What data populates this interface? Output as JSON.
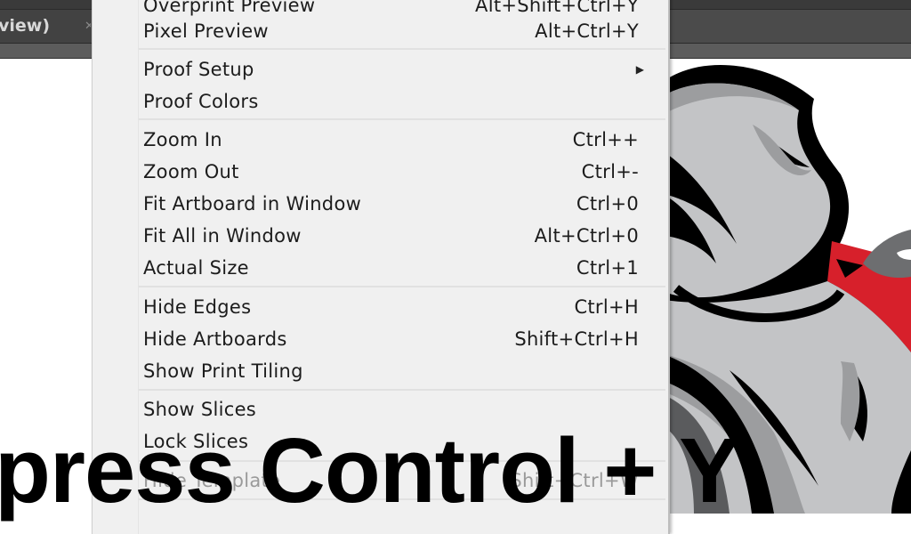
{
  "app": {
    "document_tab": {
      "label": "view)",
      "close_icon": "close-icon"
    }
  },
  "menu": {
    "items": [
      {
        "label": "Overprint Preview",
        "shortcut": "Alt+Shift+Ctrl+Y",
        "enabled": true
      },
      {
        "label": "Pixel Preview",
        "shortcut": "Alt+Ctrl+Y",
        "enabled": true
      },
      {
        "label": "Proof Setup",
        "shortcut": "",
        "submenu": true,
        "submenu_icon": "triangle-right-icon",
        "enabled": true
      },
      {
        "label": "Proof Colors",
        "shortcut": "",
        "enabled": true
      },
      {
        "label": "Zoom In",
        "shortcut": "Ctrl++",
        "enabled": true
      },
      {
        "label": "Zoom Out",
        "shortcut": "Ctrl+-",
        "enabled": true
      },
      {
        "label": "Fit Artboard in Window",
        "shortcut": "Ctrl+0",
        "enabled": true
      },
      {
        "label": "Fit All in Window",
        "shortcut": "Alt+Ctrl+0",
        "enabled": true
      },
      {
        "label": "Actual Size",
        "shortcut": "Ctrl+1",
        "enabled": true
      },
      {
        "label": "Hide Edges",
        "shortcut": "Ctrl+H",
        "enabled": true
      },
      {
        "label": "Hide Artboards",
        "shortcut": "Shift+Ctrl+H",
        "enabled": true
      },
      {
        "label": "Show Print Tiling",
        "shortcut": "",
        "enabled": true
      },
      {
        "label": "Show Slices",
        "shortcut": "",
        "enabled": true
      },
      {
        "label": "Lock Slices",
        "shortcut": "",
        "enabled": true
      },
      {
        "label": "Hide Template",
        "shortcut": "Shift+Ctrl+W",
        "enabled": false
      }
    ]
  },
  "caption": {
    "text": "press Control + Y"
  },
  "colors": {
    "menu_bg": "#f0f0f0",
    "chrome_dark": "#4a4a4a",
    "art_red": "#d7202b",
    "art_grey_light": "#c3c4c6",
    "art_grey_mid": "#9c9d9f"
  }
}
